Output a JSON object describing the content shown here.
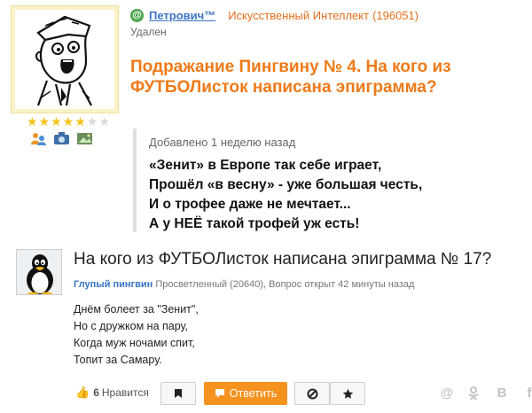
{
  "top_post": {
    "author": "Петрович™",
    "author_rank": "Искусственный Интеллект",
    "author_score": "(196051)",
    "status": "Удален",
    "title": "Подражание Пингвину № 4. На кого из ФУТБОЛисток написана эпиграмма?",
    "rating_stars": {
      "filled": 5,
      "total": 7
    },
    "badges": [
      "people-badge-icon",
      "camera-badge-icon",
      "photo-badge-icon"
    ],
    "quote": {
      "meta": "Добавлено 1 неделю назад",
      "text": "«Зенит» в Европе так себе играет,\nПрошёл «в весну» - уже большая честь,\nИ о трофее даже не мечтает...\nА у НЕЁ такой трофей уж есть!"
    }
  },
  "question": {
    "title": "На кого из ФУТБОЛисток написана эпиграмма № 17?",
    "author": "Глупый пингвин",
    "author_rank": "Просветленный (20640),",
    "meta": "Вопрос открыт 42 минуты назад",
    "body": "Днём болеет за \"Зенит\",\nНо с дружком на пару,\nКогда муж ночами спит,\nТопит за Самару."
  },
  "actions": {
    "like_count": "6",
    "like_label": "Нравится",
    "reply_label": "Ответить"
  },
  "colors": {
    "accent_orange": "#f6921e",
    "title_orange": "#ee7a18",
    "link_blue": "#3a74c4"
  }
}
